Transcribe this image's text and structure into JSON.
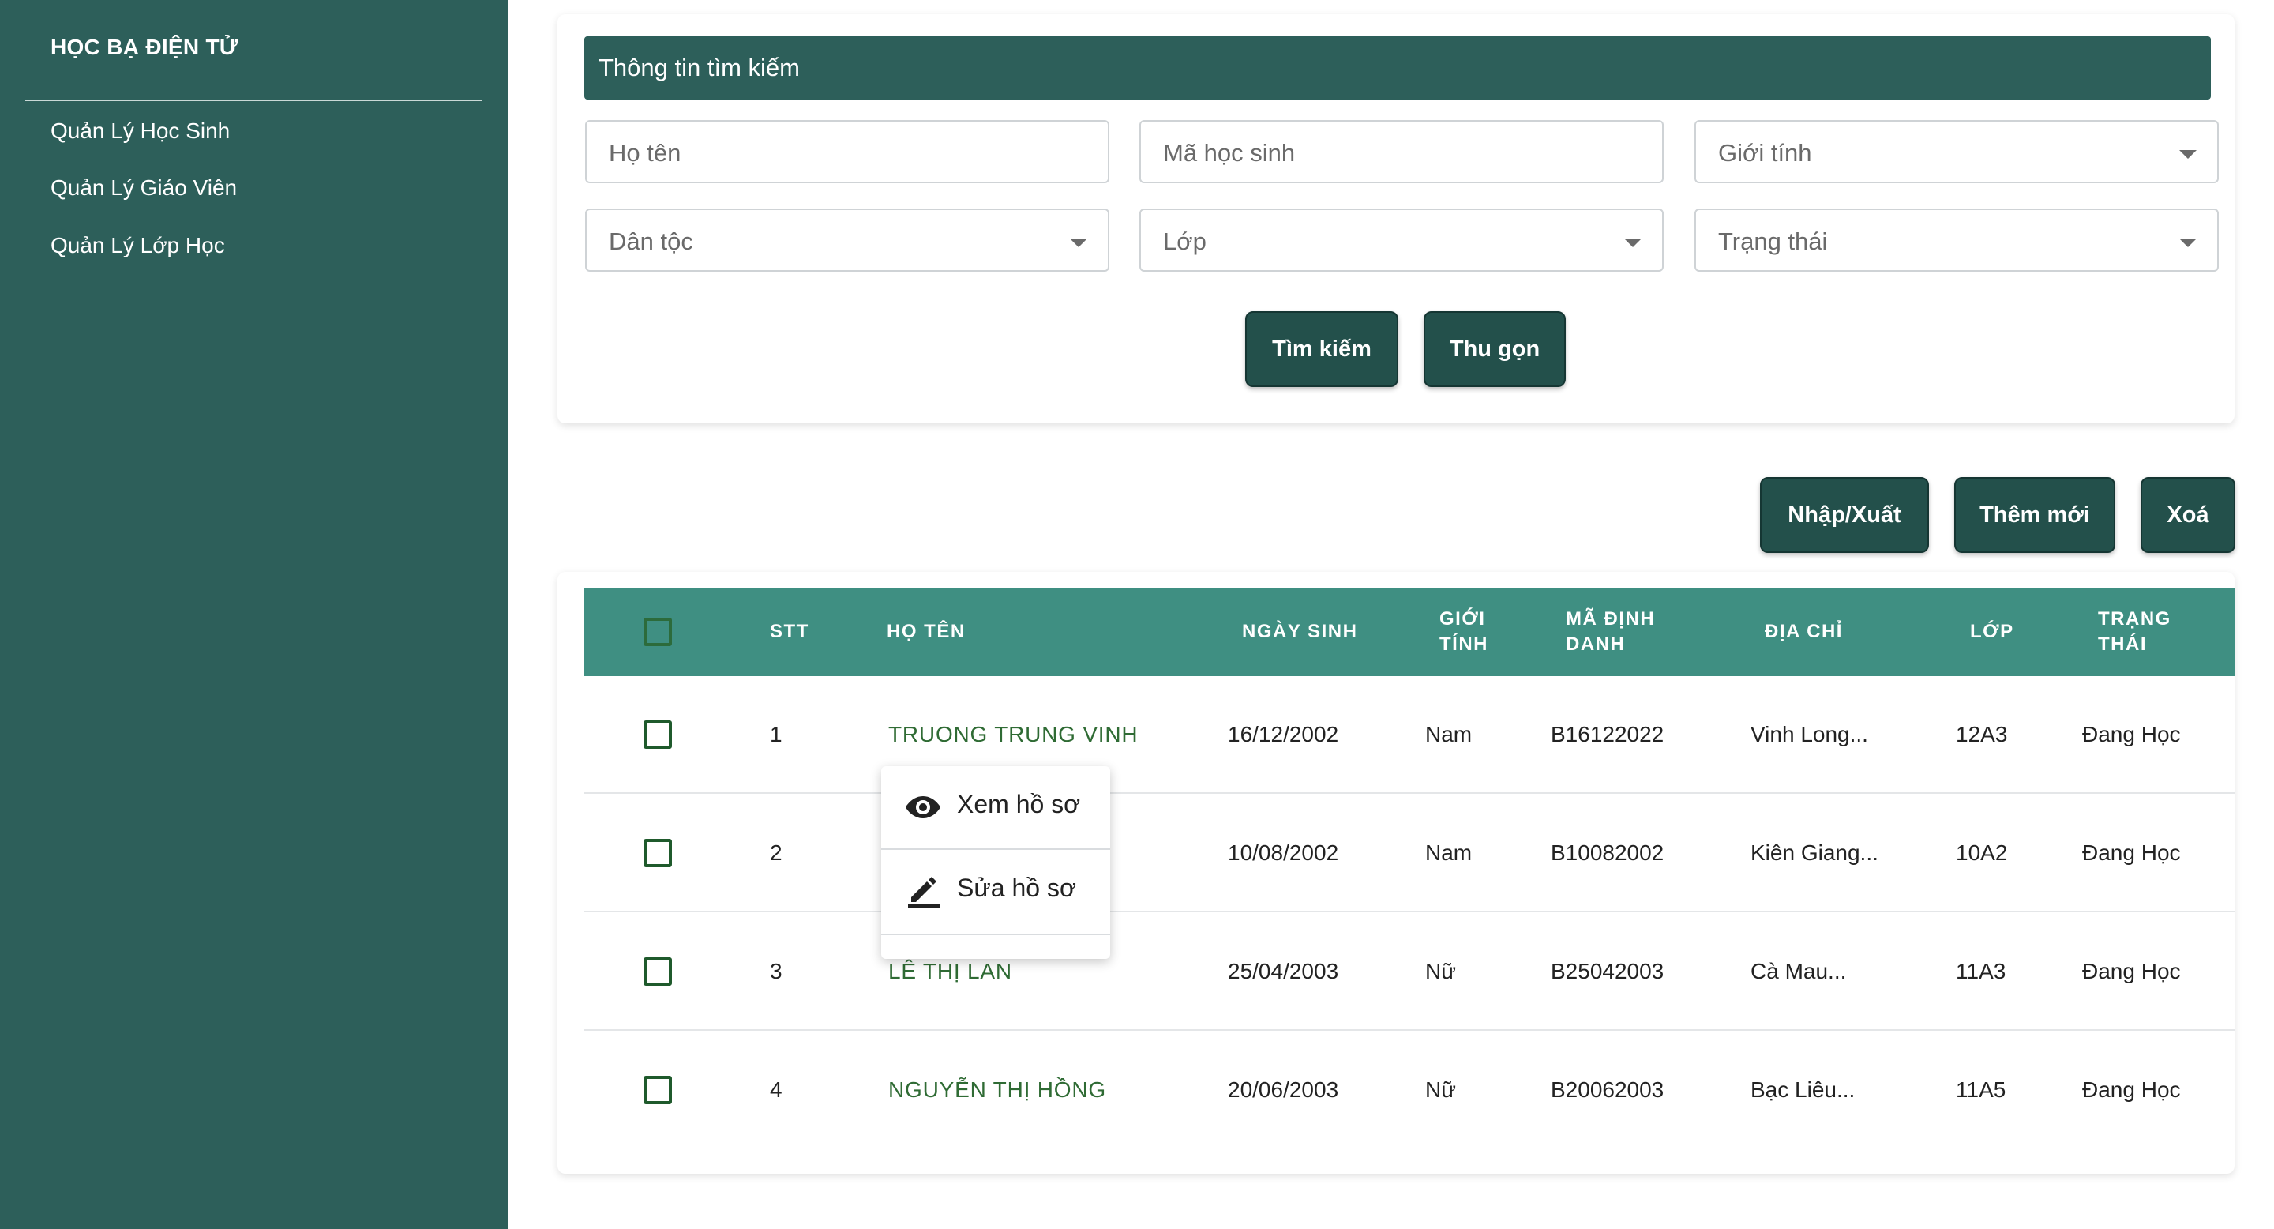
{
  "sidebar": {
    "brand": "HỌC BẠ ĐIỆN TỬ",
    "items": [
      {
        "label": "Quản Lý Học Sinh"
      },
      {
        "label": "Quản Lý Giáo Viên"
      },
      {
        "label": "Quản Lý Lớp Học"
      }
    ]
  },
  "search": {
    "title": "Thông tin tìm kiếm",
    "fields": {
      "name_placeholder": "Họ tên",
      "student_id_placeholder": "Mã học sinh",
      "gender": "Giới tính",
      "ethnicity": "Dân tộc",
      "class": "Lớp",
      "status": "Trạng thái"
    },
    "search_button": "Tìm kiếm",
    "collapse_button": "Thu gọn"
  },
  "actions": {
    "import_export": "Nhập/Xuất",
    "add_new": "Thêm mới",
    "delete": "Xoá"
  },
  "table": {
    "columns": {
      "stt": "STT",
      "name": "HỌ TÊN",
      "dob": "NGÀY SINH",
      "gender_line1": "GIỚI",
      "gender_line2": "TÍNH",
      "id_line1": "MÃ ĐỊNH",
      "id_line2": "DANH",
      "address": "ĐỊA CHỈ",
      "class": "LỚP",
      "status_line1": "TRẠNG",
      "status_line2": "THÁI"
    },
    "rows": [
      {
        "stt": "1",
        "name": "TRUONG TRUNG VINH",
        "dob": "16/12/2002",
        "gender": "Nam",
        "id": "B16122022",
        "address": "Vinh Long...",
        "class": "12A3",
        "status": "Đang Học"
      },
      {
        "stt": "2",
        "name": "",
        "dob": "10/08/2002",
        "gender": "Nam",
        "id": "B10082002",
        "address": "Kiên Giang...",
        "class": "10A2",
        "status": "Đang Học"
      },
      {
        "stt": "3",
        "name": "LÊ THỊ LAN",
        "dob": "25/04/2003",
        "gender": "Nữ",
        "id": "B25042003",
        "address": "Cà Mau...",
        "class": "11A3",
        "status": "Đang Học"
      },
      {
        "stt": "4",
        "name": "NGUYỄN THỊ HỒNG",
        "dob": "20/06/2003",
        "gender": "Nữ",
        "id": "B20062003",
        "address": "Bạc Liêu...",
        "class": "11A5",
        "status": "Đang Học"
      }
    ]
  },
  "context_menu": {
    "view": {
      "label": "Xem hồ sơ",
      "icon": "eye-icon"
    },
    "edit": {
      "label": "Sửa hồ sơ",
      "icon": "pencil-icon"
    }
  },
  "colors": {
    "sidebar": "#2d5f5a",
    "header_bar": "#2d5f5a",
    "table_header": "#3f8f82",
    "button": "#23504b",
    "name_text": "#2f6b34"
  }
}
